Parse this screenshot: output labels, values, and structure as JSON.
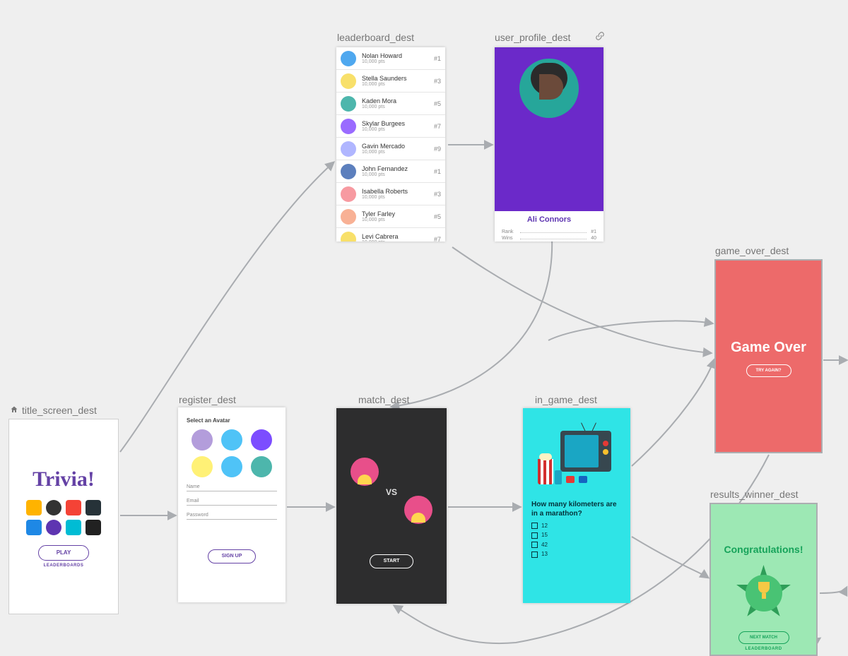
{
  "destinations": {
    "title_screen": {
      "label": "title_screen_dest",
      "is_home": true
    },
    "register": {
      "label": "register_dest"
    },
    "leaderboard": {
      "label": "leaderboard_dest"
    },
    "user_profile": {
      "label": "user_profile_dest",
      "has_link_icon": true
    },
    "match": {
      "label": "match_dest"
    },
    "in_game": {
      "label": "in_game_dest"
    },
    "game_over": {
      "label": "game_over_dest"
    },
    "results_winner": {
      "label": "results_winner_dest"
    }
  },
  "title_screen": {
    "app_name": "Trivia!",
    "play_label": "PLAY",
    "leaderboards_label": "LEADERBOARDS"
  },
  "register": {
    "select_avatar_label": "Select an Avatar",
    "fields": {
      "name": "Name",
      "email": "Email",
      "password": "Password"
    },
    "signup_label": "SIGN UP",
    "avatar_colors": [
      "#b39ddb",
      "#4fc3f7",
      "#7c4dff",
      "#fff176",
      "#4fc3f7",
      "#4db6ac"
    ]
  },
  "leaderboard": {
    "points_text": "10,000 pts",
    "rows": [
      {
        "name": "Nolan Howard",
        "rank": "#1",
        "color": "#4fa8ef"
      },
      {
        "name": "Stella Saunders",
        "rank": "#3",
        "color": "#f8e06a"
      },
      {
        "name": "Kaden Mora",
        "rank": "#5",
        "color": "#4db6ac"
      },
      {
        "name": "Skylar Burgees",
        "rank": "#7",
        "color": "#9a6bff"
      },
      {
        "name": "Gavin Mercado",
        "rank": "#9",
        "color": "#b0b6ff"
      },
      {
        "name": "John Fernandez",
        "rank": "#1",
        "color": "#5c7fbd"
      },
      {
        "name": "Isabella Roberts",
        "rank": "#3",
        "color": "#f79aa1"
      },
      {
        "name": "Tyler Farley",
        "rank": "#5",
        "color": "#f8b195"
      },
      {
        "name": "Levi Cabrera",
        "rank": "#7",
        "color": "#f8e06a"
      }
    ]
  },
  "user_profile": {
    "name": "Ali Connors",
    "stats": [
      {
        "label": "Rank",
        "value": "#1"
      },
      {
        "label": "Wins",
        "value": "40"
      }
    ]
  },
  "match": {
    "vs_label": "VS",
    "start_label": "START"
  },
  "in_game": {
    "question": "How many kilometers are in a marathon?",
    "options": [
      "12",
      "15",
      "42",
      "13"
    ]
  },
  "game_over": {
    "title": "Game Over",
    "try_again_label": "TRY AGAIN?"
  },
  "results_winner": {
    "title": "Congratulations!",
    "next_match_label": "NEXT MATCH",
    "leaderboard_label": "LEADERBOARD"
  }
}
